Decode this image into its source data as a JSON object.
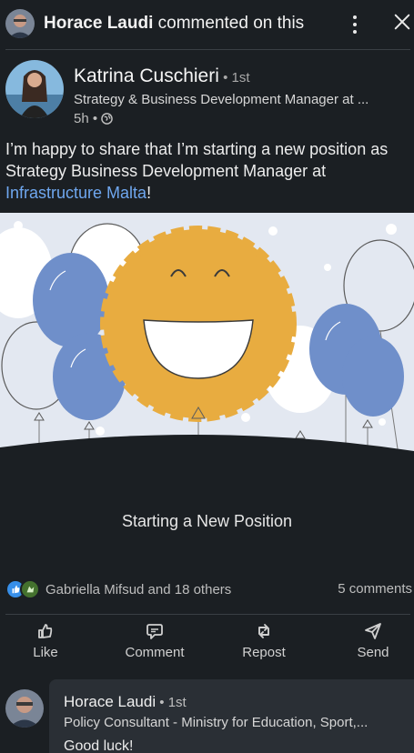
{
  "notification": {
    "commenter_name": "Horace Laudi",
    "action_text": " commented on this"
  },
  "post": {
    "author_name": "Katrina Cuschieri",
    "author_degree": " • 1st",
    "author_headline": "Strategy & Business Development Manager at ...",
    "time_ago": "5h •",
    "text_before_link": "I’m happy to share that I’m starting a new position as Strategy Business Development Manager at ",
    "link_text": "Infrastructure Malta",
    "text_after_link": "!",
    "card_caption": "Starting a New Position"
  },
  "social": {
    "reactors_text": "Gabriella Mifsud and 18 others",
    "comments_text": "5 comments"
  },
  "actions": {
    "like": "Like",
    "comment": "Comment",
    "repost": "Repost",
    "send": "Send"
  },
  "comment": {
    "author_name": "Horace Laudi",
    "author_degree": " • 1st",
    "author_headline": "Policy Consultant - Ministry for Education, Sport,...",
    "text": "Good luck!"
  },
  "colors": {
    "background": "#1b1f23",
    "link": "#6fa7ef",
    "balloon_blue": "#6f8fca",
    "sun_orange": "#e8ac40",
    "hero_sky": "#e3e8f1"
  },
  "icons": {
    "more": "kebab-icon",
    "close": "close-icon",
    "visibility": "globe-icon",
    "like": "thumbs-up-icon",
    "comment": "speech-bubble-icon",
    "repost": "repost-arrows-icon",
    "send": "paper-plane-icon"
  }
}
